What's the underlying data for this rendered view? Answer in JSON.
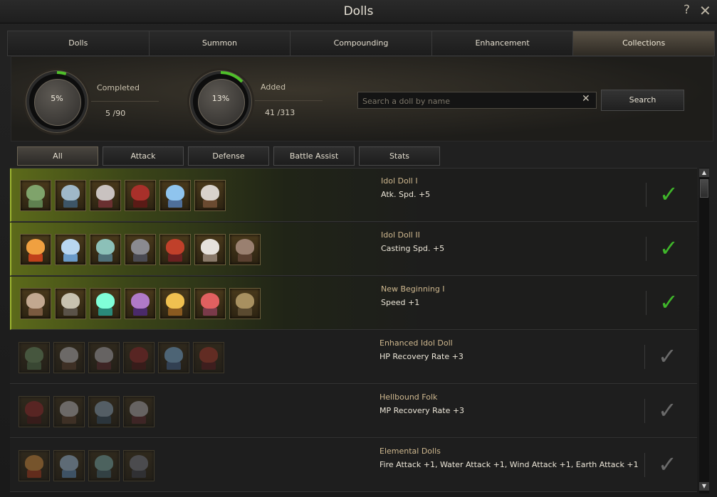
{
  "window": {
    "title": "Dolls"
  },
  "tabs": [
    {
      "label": "Dolls"
    },
    {
      "label": "Summon"
    },
    {
      "label": "Compounding"
    },
    {
      "label": "Enhancement"
    },
    {
      "label": "Collections"
    }
  ],
  "active_tab": "Collections",
  "stats": {
    "completed": {
      "percent_label": "5%",
      "label": "Completed",
      "count": "5 /90",
      "fraction": 0.05
    },
    "added": {
      "percent_label": "13%",
      "label": "Added",
      "count": "41 /313",
      "fraction": 0.13
    }
  },
  "search": {
    "placeholder": "Search a doll by name",
    "value": "",
    "button_label": "Search"
  },
  "filters": [
    {
      "label": "All"
    },
    {
      "label": "Attack"
    },
    {
      "label": "Defense"
    },
    {
      "label": "Battle Assist"
    },
    {
      "label": "Stats"
    }
  ],
  "active_filter": "All",
  "collections": [
    {
      "name": "Idol Doll I",
      "effect": "Atk. Spd. +5",
      "completed": true,
      "dolls": [
        "frog-doll-icon",
        "ice-ghost-doll-icon",
        "grey-wraith-doll-icon",
        "red-demon-doll-icon",
        "crystal-spirit-doll-icon",
        "white-hair-knight-doll-icon"
      ]
    },
    {
      "name": "Idol Doll II",
      "effect": "Casting Spd. +5",
      "completed": true,
      "dolls": [
        "fire-spirit-doll-icon",
        "water-spirit-doll-icon",
        "wind-spirit-doll-icon",
        "earth-golem-doll-icon",
        "red-imp-doll-icon",
        "white-hair-elf-doll-icon",
        "wolf-beast-doll-icon"
      ]
    },
    {
      "name": "New Beginning I",
      "effect": "Speed +1",
      "completed": true,
      "dolls": [
        "mummy-doll-icon",
        "skeleton-doll-icon",
        "crystal-orb-doll-icon",
        "witch-doll-icon",
        "golden-mask-doll-icon",
        "red-hair-lady-doll-icon",
        "lizard-doll-icon"
      ]
    },
    {
      "name": "Enhanced Idol Doll",
      "effect": "HP Recovery Rate +3",
      "completed": false,
      "dolls": [
        "frog-doll-icon",
        "white-hair-knight-doll-icon",
        "grey-wraith-doll-icon",
        "red-demon-doll-icon",
        "crystal-spirit-doll-icon",
        "red-imp-doll-icon"
      ]
    },
    {
      "name": "Hellbound Folk",
      "effect": "MP Recovery Rate +3",
      "completed": false,
      "dolls": [
        "red-demon-doll-icon",
        "white-hair-knight-doll-icon",
        "ice-ghost-doll-icon",
        "grey-wraith-doll-icon"
      ]
    },
    {
      "name": "Elemental Dolls",
      "effect": "Fire Attack +1, Water Attack +1, Wind Attack +1, Earth Attack +1",
      "completed": false,
      "dolls": [
        "fire-spirit-doll-icon",
        "water-spirit-doll-icon",
        "wind-spirit-doll-icon",
        "earth-golem-doll-icon"
      ]
    }
  ],
  "doll_colors": {
    "frog-doll-icon": [
      "#7fa36b",
      "#5f8050"
    ],
    "ice-ghost-doll-icon": [
      "#9fb8c8",
      "#3d5566"
    ],
    "grey-wraith-doll-icon": [
      "#c9c2c0",
      "#6a3030"
    ],
    "red-demon-doll-icon": [
      "#a8302a",
      "#5a1b16"
    ],
    "crystal-spirit-doll-icon": [
      "#8fc4ee",
      "#4f6f9a"
    ],
    "white-hair-knight-doll-icon": [
      "#d8d2cc",
      "#6a4a30"
    ],
    "fire-spirit-doll-icon": [
      "#f0a040",
      "#c0401a"
    ],
    "water-spirit-doll-icon": [
      "#b8d6f0",
      "#6a9ac8"
    ],
    "wind-spirit-doll-icon": [
      "#8cc0b8",
      "#4f6f78"
    ],
    "earth-golem-doll-icon": [
      "#8a8a90",
      "#4a4a52"
    ],
    "red-imp-doll-icon": [
      "#c0402a",
      "#6a2020"
    ],
    "white-hair-elf-doll-icon": [
      "#e6e2dc",
      "#8a7a6a"
    ],
    "wolf-beast-doll-icon": [
      "#9a8070",
      "#5a4030"
    ],
    "mummy-doll-icon": [
      "#c2a890",
      "#7a5a40"
    ],
    "skeleton-doll-icon": [
      "#c8c2b0",
      "#5a5248"
    ],
    "crystal-orb-doll-icon": [
      "#80ffd8",
      "#2a8a7a"
    ],
    "witch-doll-icon": [
      "#b07ac8",
      "#4a2a6a"
    ],
    "golden-mask-doll-icon": [
      "#f0c050",
      "#8a5a20"
    ],
    "red-hair-lady-doll-icon": [
      "#e06060",
      "#7a3a4a"
    ],
    "lizard-doll-icon": [
      "#a89060",
      "#5a4a30"
    ]
  },
  "colors": {
    "check_done": "#3fb52a",
    "check_pending": "#6a6a6a",
    "accent_green": "#9db530"
  }
}
